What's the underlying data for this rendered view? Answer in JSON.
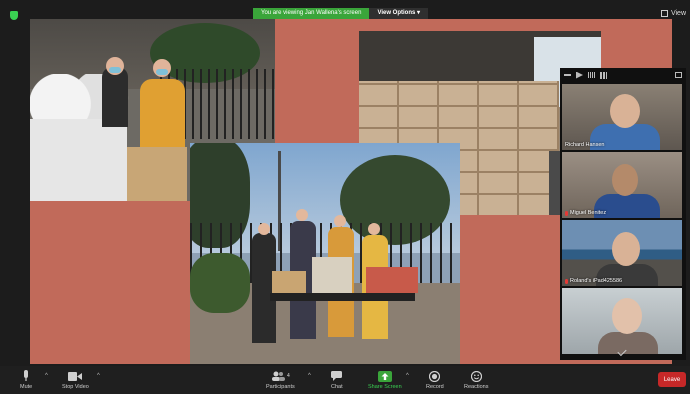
{
  "share_banner": {
    "status_text": "You are viewing Jan Wallena's screen",
    "view_options_label": "View Options"
  },
  "view_button_label": "View",
  "gallery": {
    "participants": [
      {
        "name": "Richard Hansen"
      },
      {
        "name": "Miguel Benitez"
      },
      {
        "name": "Roland's iPad425586"
      },
      {
        "name": ""
      }
    ]
  },
  "toolbar": {
    "mute_label": "Mute",
    "stop_video_label": "Stop Video",
    "participants_label": "Participants",
    "participants_count": "4",
    "chat_label": "Chat",
    "share_screen_label": "Share Screen",
    "record_label": "Record",
    "reactions_label": "Reactions",
    "leave_label": "Leave"
  },
  "colors": {
    "slide_background": "#c16a5a",
    "share_green": "#3aa53a",
    "leave_red": "#c62828"
  }
}
